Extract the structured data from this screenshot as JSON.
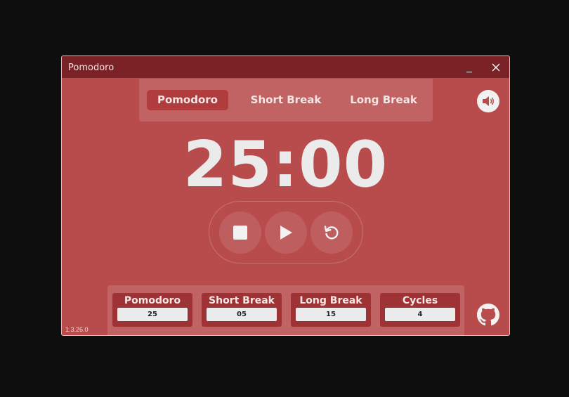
{
  "window": {
    "title": "Pomodoro",
    "version": "1.3.26.0"
  },
  "tabs": [
    {
      "label": "Pomodoro",
      "active": true
    },
    {
      "label": "Short Break",
      "active": false
    },
    {
      "label": "Long Break",
      "active": false
    }
  ],
  "timer": {
    "display": "25:00"
  },
  "controls": {
    "icons": [
      "stop-icon",
      "play-icon",
      "reset-icon"
    ]
  },
  "settings": [
    {
      "label": "Pomodoro",
      "value": "25"
    },
    {
      "label": "Short Break",
      "value": "05"
    },
    {
      "label": "Long Break",
      "value": "15"
    },
    {
      "label": "Cycles",
      "value": "4"
    }
  ],
  "icons": {
    "sound": "speaker-icon",
    "github": "github-icon"
  },
  "colors": {
    "background": "#b84c4c",
    "titlebar": "#7a2225",
    "active_tab": "#b03c3e",
    "setting_card": "#9e3235",
    "text": "#ebebeb"
  }
}
